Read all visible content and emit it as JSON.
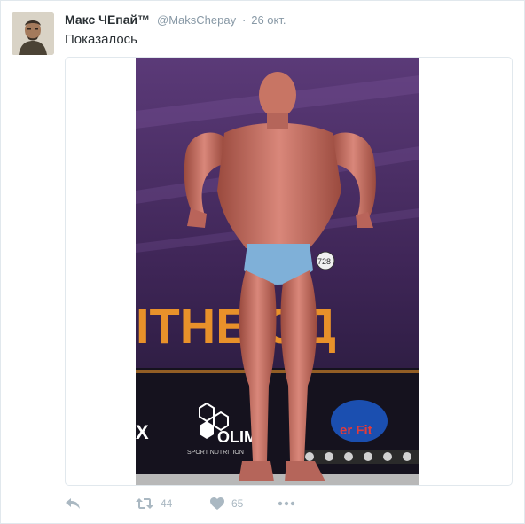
{
  "tweet": {
    "display_name": "Макс ЧЕпай™",
    "handle": "@MaksChepay",
    "separator": "·",
    "time": "26 окт.",
    "text": "Показалось"
  },
  "media": {
    "banner_text": "ITHE ОД",
    "sponsor_left": "OLIMP",
    "sponsor_left_sub": "SPORT NUTRITION",
    "sponsor_right": "er Fit",
    "number_tag": "728"
  },
  "actions": {
    "reply_icon": "reply-icon",
    "retweet_icon": "retweet-icon",
    "retweet_count": "44",
    "like_icon": "heart-icon",
    "like_count": "65",
    "more_icon": "more-icon",
    "icon_color": "#aab8c2"
  },
  "colors": {
    "name": "#292f33",
    "secondary": "#8899a6",
    "border": "#e1e8ed",
    "banner_text": "#e8912a",
    "stage_purple": "#4a2c63"
  }
}
